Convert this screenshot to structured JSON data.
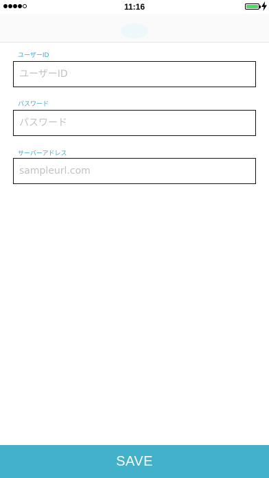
{
  "status_bar": {
    "time": "11:16",
    "signal_bars_filled": 4,
    "signal_bars_total": 5,
    "battery_level": 1.0,
    "battery_color": "#4cd964",
    "charging_icon": "bolt-icon"
  },
  "nav_bar": {
    "logo_icon": "app-logo-icon"
  },
  "form": {
    "user_id": {
      "label": "ユーザーID",
      "placeholder": "ユーザーID",
      "value": ""
    },
    "password": {
      "label": "パスワード",
      "placeholder": "パスワード",
      "value": ""
    },
    "server_address": {
      "label": "サーバーアドレス",
      "placeholder": "sampleurl.com",
      "value": ""
    }
  },
  "save_button": {
    "label": "SAVE"
  },
  "colors": {
    "accent": "#43b1ca",
    "label_text": "#3fa7c2",
    "placeholder": "#c2c2c2",
    "field_border": "#111111"
  }
}
